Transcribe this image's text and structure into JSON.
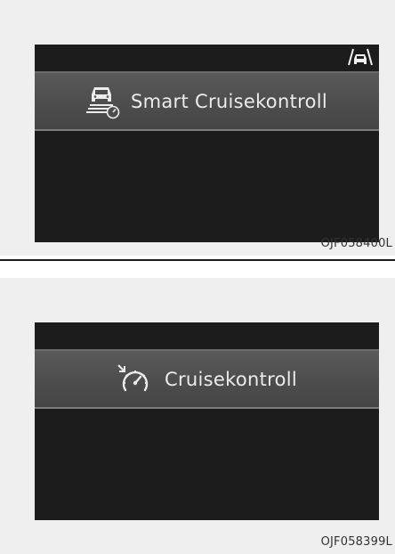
{
  "figures": [
    {
      "display_message": "Smart Cruisekontroll",
      "icon": "smart-cruise-control-icon",
      "status_indicator_icon": "lane-car-indicator-icon",
      "figure_code": "OJF058400L"
    },
    {
      "display_message": "Cruisekontroll",
      "icon": "cruise-control-icon",
      "figure_code": "OJF058399L"
    }
  ],
  "colors": {
    "screen_background": "#1c1c1c",
    "banner_background": "#4d4d4d",
    "banner_text": "#ececec",
    "page_background": "#efefef"
  }
}
